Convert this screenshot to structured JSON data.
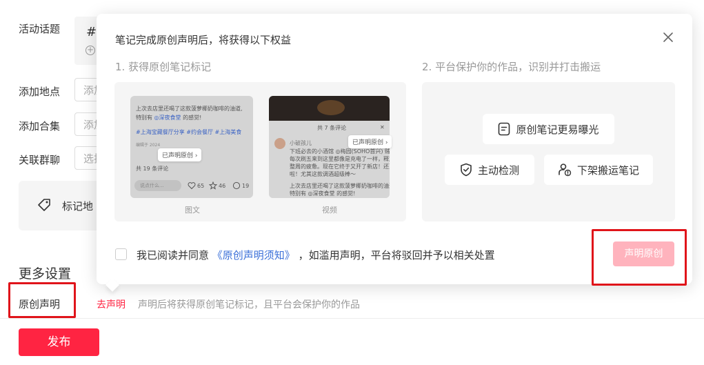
{
  "form": {
    "topic_label": "活动话题",
    "topic_hash": "#",
    "topic_add": "+",
    "location_label": "添加地点",
    "location_placeholder": "添加",
    "collection_label": "添加合集",
    "collection_placeholder": "添加",
    "group_label": "关联群聊",
    "group_placeholder": "选择",
    "mark_location_label": "标记地",
    "more_settings": "更多设置",
    "original_label": "原创声明",
    "declare_link": "去声明",
    "declare_hint": "声明后将获得原创笔记标记，且平台会保护你的作品",
    "publish_button": "发布"
  },
  "popup": {
    "title": "笔记完成原创声明后，将获得以下权益",
    "section1_title": "1. 获得原创笔记标记",
    "section2_title": "2. 平台保护你的作品，识别并打击搬运",
    "image_text": {
      "caption": "图文",
      "line1": "上次去店里还喝了这款菠萝椰奶咖啡的油道,",
      "line2": "特别有",
      "line2_tag": "◎深夜食堂",
      "line2_end": "的感觉!",
      "tags": "#上海宝藏餐厅分享  #约会餐厅  #上海美食",
      "date": "编辑于 2024",
      "badge": "已声明原创",
      "comments": "共 19 条评论",
      "input_placeholder": "说点什么...",
      "likes": "65",
      "stars": "46",
      "replies": "19"
    },
    "video": {
      "caption": "视频",
      "comments_header": "共 7 条评论",
      "author": "小破孩儿",
      "badge": "已声明原创",
      "line1": "下班必去的小酒馆 ◎梅园(SOHO首兴) 贼吧!",
      "line2": "每次刷五来到这里都像是充电了一样，释放一",
      "line3": "整周的疲惫。现在它终于又开了新店！还更酷",
      "line4": "啦！尤其这款调酒超级棒～",
      "line5": "上次去店里还喝了这款菠萝椰奶咖啡的油道,",
      "line6": "特别有 ◎深夜食堂 的感觉!"
    },
    "benefits": {
      "exposure": "原创笔记更易曝光",
      "detect": "主动检测",
      "takedown": "下架搬运笔记"
    },
    "agree_prefix": "我已阅读并同意",
    "agree_link": "《原创声明须知》",
    "agree_suffix": "，如滥用声明，平台将驳回并予以相关处置",
    "declare_button": "声明原创"
  }
}
